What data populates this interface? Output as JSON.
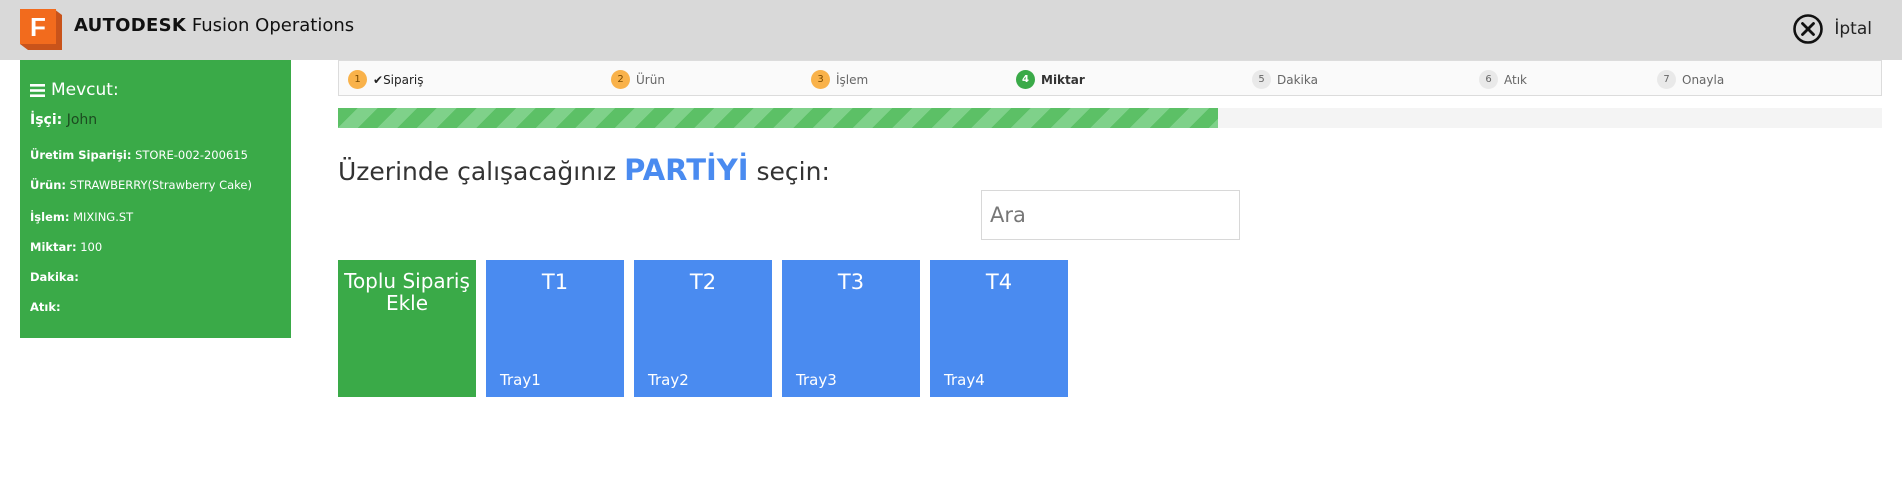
{
  "header": {
    "logo_letter": "F",
    "brand_bold": "AUTODESK",
    "brand_rest": "Fusion Operations",
    "cancel_label": "İptal"
  },
  "sidebar": {
    "title": "Mevcut:",
    "worker": {
      "label": "İşçi:",
      "value": "John"
    },
    "rows": [
      {
        "label": "Üretim Siparişi:",
        "value": "STORE-002-200615"
      },
      {
        "label": "Ürün:",
        "value": "STRAWBERRY(Strawberry Cake)"
      },
      {
        "label": "İşlem:",
        "value": "MIXING.ST"
      },
      {
        "label": "Miktar:",
        "value": "100"
      },
      {
        "label": "Dakika:",
        "value": ""
      },
      {
        "label": "Atık:",
        "value": ""
      }
    ]
  },
  "steps": [
    {
      "num": "1",
      "label": "Sipariş",
      "state": "done",
      "check": "✔"
    },
    {
      "num": "2",
      "label": "Ürün",
      "state": "done"
    },
    {
      "num": "3",
      "label": "İşlem",
      "state": "done"
    },
    {
      "num": "4",
      "label": "Miktar",
      "state": "current"
    },
    {
      "num": "5",
      "label": "Dakika",
      "state": "pending"
    },
    {
      "num": "6",
      "label": "Atık",
      "state": "pending"
    },
    {
      "num": "7",
      "label": "Onayla",
      "state": "pending"
    }
  ],
  "progress": {
    "fraction": 0.57
  },
  "heading": {
    "pre": "Üzerinde çalışacağınız",
    "highlight": "PARTİYİ",
    "post": "seçin:"
  },
  "search": {
    "placeholder": "Ara",
    "value": ""
  },
  "add_tile": {
    "label": "Toplu Sipariş Ekle"
  },
  "batches": [
    {
      "code": "T1",
      "name": "Tray1"
    },
    {
      "code": "T2",
      "name": "Tray2"
    },
    {
      "code": "T3",
      "name": "Tray3"
    },
    {
      "code": "T4",
      "name": "Tray4"
    }
  ],
  "colors": {
    "green": "#3aaa48",
    "blue": "#4a8bf0",
    "orange": "#f9b24a",
    "logo_orange": "#f26b1d"
  }
}
